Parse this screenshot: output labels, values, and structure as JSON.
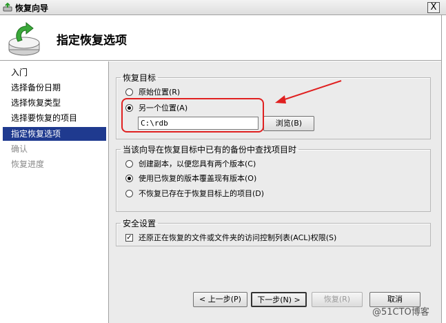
{
  "window": {
    "title": "恢复向导",
    "close_label": "X"
  },
  "header": {
    "title": "指定恢复选项"
  },
  "sidebar": {
    "items": [
      {
        "label": "入门"
      },
      {
        "label": "选择备份日期"
      },
      {
        "label": "选择恢复类型"
      },
      {
        "label": "选择要恢复的项目"
      },
      {
        "label": "指定恢复选项"
      },
      {
        "label": "确认"
      },
      {
        "label": "恢复进度"
      }
    ]
  },
  "restore_target": {
    "legend": "恢复目标",
    "original_label": "原始位置(R)",
    "other_label": "另一个位置(A)",
    "path_value": "C:\\rdb",
    "browse_label": "浏览(B)"
  },
  "conflict": {
    "legend": "当该向导在恢复目标中已有的备份中查找项目时",
    "copy_label": "创建副本，以便您具有两个版本(C)",
    "overwrite_label": "使用已恢复的版本覆盖现有版本(O)",
    "skip_label": "不恢复已存在于恢复目标上的项目(D)"
  },
  "security": {
    "legend": "安全设置",
    "acl_label": "还原正在恢复的文件或文件夹的访问控制列表(ACL)权限(S)"
  },
  "footer": {
    "back_label": "< 上一步(P)",
    "next_label": "下一步(N) >",
    "restore_label": "恢复(R)",
    "cancel_label": "取消"
  },
  "watermark": "@51CTO博客",
  "colors": {
    "accent": "#1f3a8f",
    "annotation": "#e02020"
  }
}
